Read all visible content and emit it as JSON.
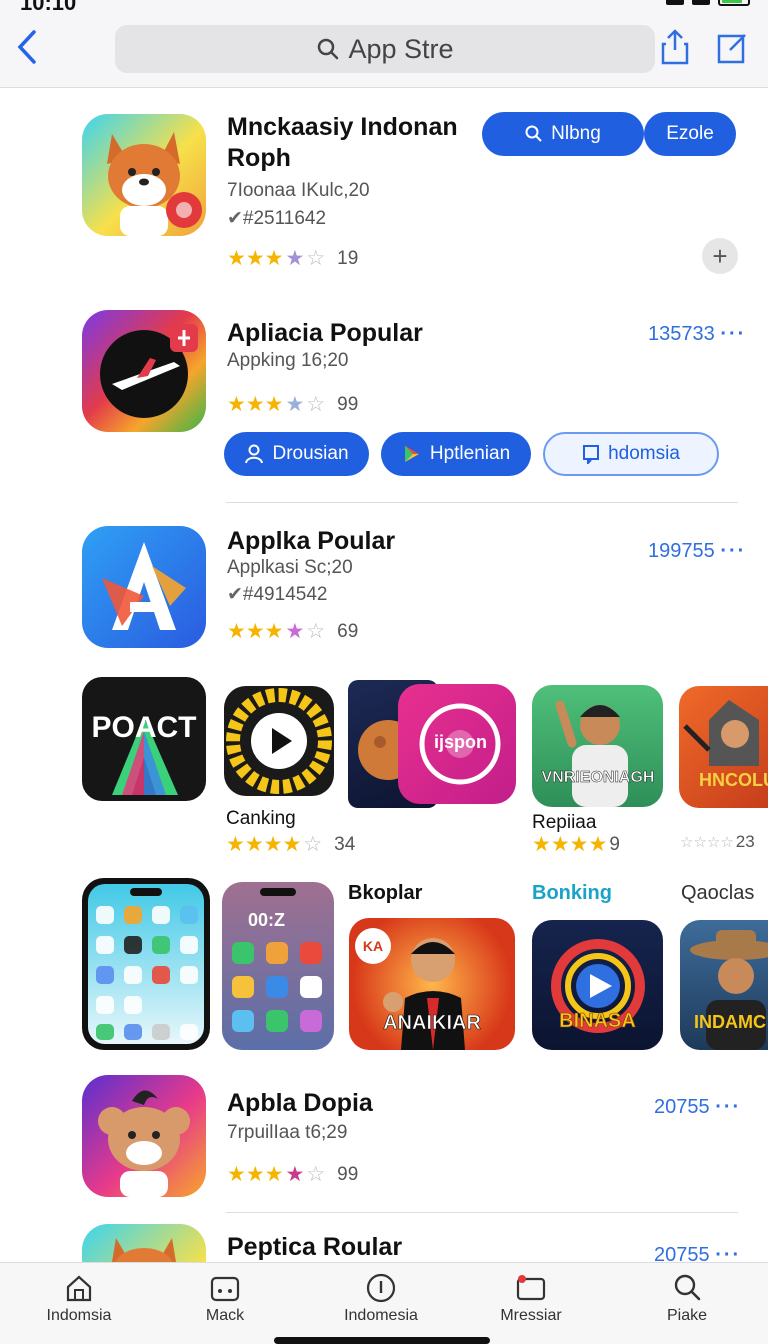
{
  "status": {
    "time": "10:10"
  },
  "header": {
    "search_text": "App Stre"
  },
  "apps": [
    {
      "title_line1": "Mnckaasiy Indonan",
      "title_line2": "Roph",
      "sub1": "7Ioonaa IKulc,20",
      "sub2": "#2511642",
      "rating_count": "19"
    },
    {
      "title": "Apliacia Popular",
      "sub1": "Appking 16;20",
      "rating_count": "99",
      "count": "135733"
    },
    {
      "title": "Applka Poular",
      "sub1": "Applkasi Sc;20",
      "sub2": "#4914542",
      "rating_count": "69",
      "count": "199755"
    },
    {
      "title": "Apbla Dopia",
      "sub1": "7rpuilIaa t6;29",
      "rating_count": "99",
      "count": "20755"
    },
    {
      "title": "Peptica Roular",
      "count": "20755"
    }
  ],
  "top_buttons": {
    "primary": "Nlbng",
    "secondary": "Ezole"
  },
  "row2_buttons": [
    "Drousian",
    "Hptlenian",
    "hdomsia"
  ],
  "gallery1": {
    "items": [
      {
        "art_text": "POACT"
      },
      {
        "label": "Canking",
        "rating": "34"
      },
      {
        "art_text": "ijspon"
      },
      {
        "label": "Repiiaa",
        "rating": "9",
        "art_text": "VNRIEONIAGH"
      },
      {
        "art_text": "HNCOLU",
        "rating": "23"
      }
    ]
  },
  "gallery2": {
    "headers": [
      "Bkoplar",
      "Bonking",
      "Qaoclas"
    ],
    "tiles": [
      {
        "clock": "00:Z"
      },
      {
        "art_text": "ANAIKIAR",
        "badge": "KA"
      },
      {
        "art_text": "BINASA"
      },
      {
        "art_text": "INDAMC"
      }
    ]
  },
  "tabbar": [
    "Indomsia",
    "Mack",
    "Indomesia",
    "Mressiar",
    "Piake"
  ],
  "colors": {
    "accent": "#1f5fe0",
    "star": "#f5b400"
  }
}
